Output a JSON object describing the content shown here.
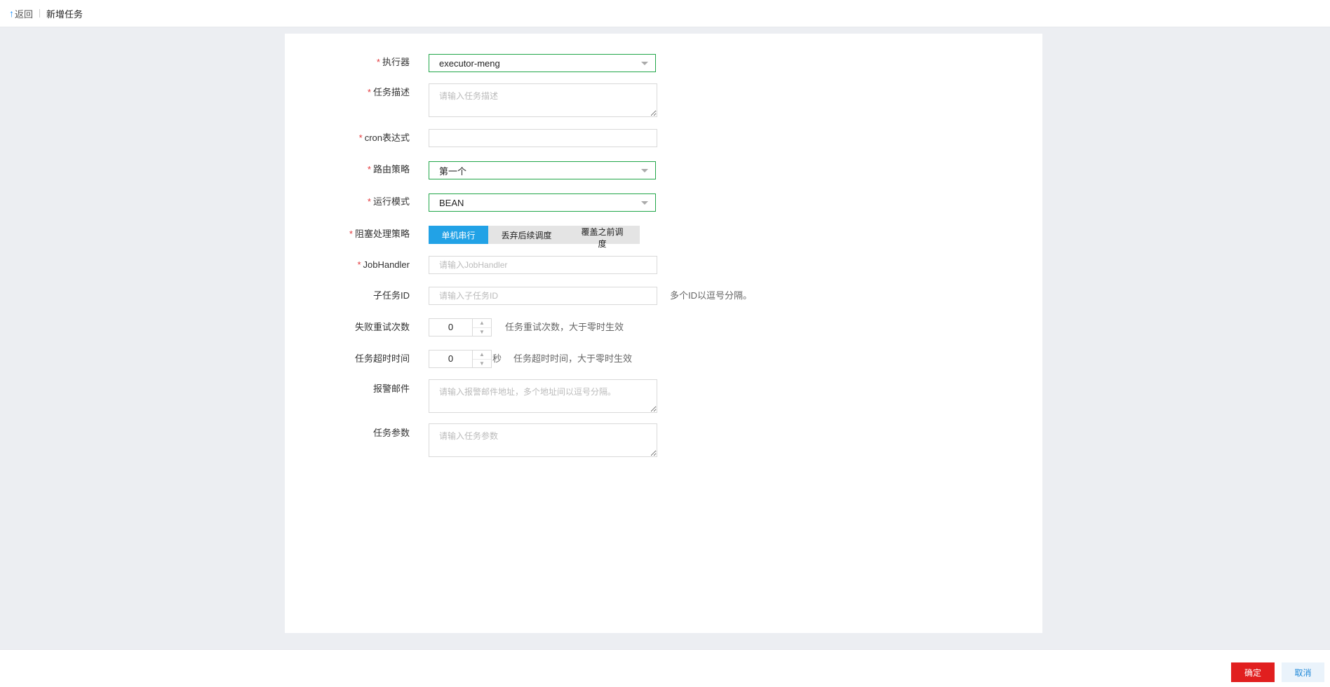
{
  "header": {
    "back_label": "返回",
    "back_arrow": "↑",
    "title": "新增任务"
  },
  "form": {
    "executor": {
      "label": "执行器",
      "required_mark": "*",
      "value": "executor-meng"
    },
    "description": {
      "label": "任务描述",
      "required_mark": "*",
      "placeholder": "请输入任务描述"
    },
    "cron": {
      "label": "cron表达式",
      "required_mark": "*",
      "value": ""
    },
    "route": {
      "label": "路由策略",
      "required_mark": "*",
      "value": "第一个"
    },
    "run_mode": {
      "label": "运行模式",
      "required_mark": "*",
      "value": "BEAN"
    },
    "block_strategy": {
      "label": "阻塞处理策略",
      "required_mark": "*",
      "options": [
        "单机串行",
        "丢弃后续调度",
        "覆盖之前调度"
      ],
      "selected": "单机串行"
    },
    "job_handler": {
      "label": "JobHandler",
      "required_mark": "*",
      "placeholder": "请输入JobHandler"
    },
    "child_task": {
      "label": "子任务ID",
      "placeholder": "请输入子任务ID",
      "hint": "多个ID以逗号分隔。"
    },
    "retry": {
      "label": "失败重试次数",
      "value": "0",
      "hint": "任务重试次数，大于零时生效"
    },
    "timeout": {
      "label": "任务超时时间",
      "value": "0",
      "unit": "秒",
      "hint": "任务超时时间，大于零时生效"
    },
    "alarm_email": {
      "label": "报警邮件",
      "placeholder": "请输入报警邮件地址，多个地址间以逗号分隔。"
    },
    "params": {
      "label": "任务参数",
      "placeholder": "请输入任务参数"
    }
  },
  "footer": {
    "ok_label": "确定",
    "cancel_label": "取消"
  },
  "colors": {
    "primary_red": "#e11f1f",
    "active_blue": "#22a2e6",
    "select_border_green": "#21a649",
    "required_red": "#e3393c"
  }
}
